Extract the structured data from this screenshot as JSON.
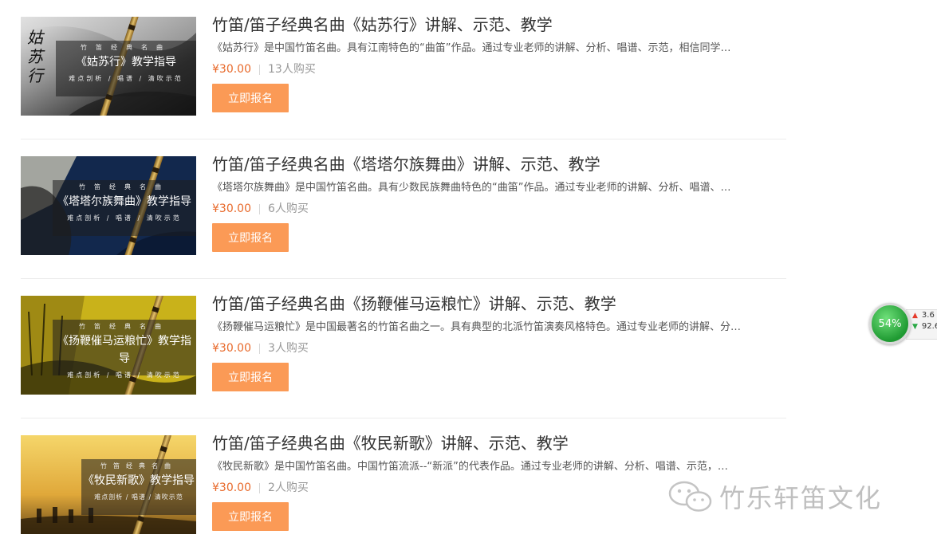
{
  "courses": [
    {
      "title": "竹笛/笛子经典名曲《姑苏行》讲解、示范、教学",
      "description": "《姑苏行》是中国竹笛名曲。具有江南特色的“曲笛”作品。通过专业老师的讲解、分析、唱谱、示范，相信同学…",
      "price": "¥30.00",
      "buyers": "13人购买",
      "button": "立即报名",
      "thumb": {
        "top": "竹笛经典名曲",
        "name": "《姑苏行》教学指导",
        "bottom": "难点剖析 / 唱谱 / 清吹示范",
        "calligraphy": "姑苏行"
      },
      "theme": "ink"
    },
    {
      "title": "竹笛/笛子经典名曲《塔塔尔族舞曲》讲解、示范、教学",
      "description": "《塔塔尔族舞曲》是中国竹笛名曲。具有少数民族舞曲特色的“曲笛”作品。通过专业老师的讲解、分析、唱谱、…",
      "price": "¥30.00",
      "buyers": "6人购买",
      "button": "立即报名",
      "thumb": {
        "top": "竹笛经典名曲",
        "name": "《塔塔尔族舞曲》教学指导",
        "bottom": "难点剖析 / 唱谱 / 清吹示范"
      },
      "theme": "navy"
    },
    {
      "title": "竹笛/笛子经典名曲《扬鞭催马运粮忙》讲解、示范、教学",
      "description": "《扬鞭催马运粮忙》是中国最著名的竹笛名曲之一。具有典型的北派竹笛演奏风格特色。通过专业老师的讲解、分…",
      "price": "¥30.00",
      "buyers": "3人购买",
      "button": "立即报名",
      "thumb": {
        "top": "竹笛经典名曲",
        "name": "《扬鞭催马运粮忙》教学指导",
        "bottom": "难点剖析 / 唱谱 / 清吹示范"
      },
      "theme": "gold"
    },
    {
      "title": "竹笛/笛子经典名曲《牧民新歌》讲解、示范、教学",
      "description": "《牧民新歌》是中国竹笛名曲。中国竹笛流派--“新派”的代表作品。通过专业老师的讲解、分析、唱谱、示范，…",
      "price": "¥30.00",
      "buyers": "2人购买",
      "button": "立即报名",
      "thumb": {
        "top": "竹笛经典名曲",
        "name": "《牧民新歌》教学指导",
        "bottom": "难点剖析 / 唱谱 / 清吹示范"
      },
      "theme": "sunset"
    }
  ],
  "widget": {
    "percent": "54%",
    "up": "3.6",
    "down": "92.6"
  },
  "watermark": {
    "text": "竹乐轩笛文化",
    "icon": "wechat-icon"
  }
}
